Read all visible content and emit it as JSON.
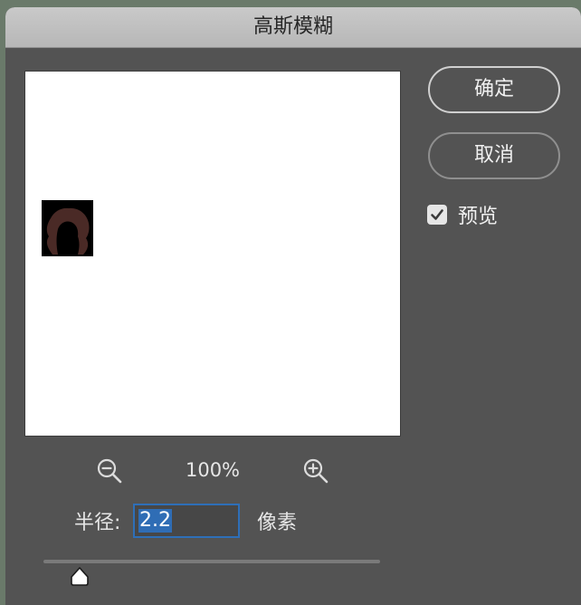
{
  "dialog": {
    "title": "高斯模糊"
  },
  "buttons": {
    "ok_label": "确定",
    "cancel_label": "取消"
  },
  "preview": {
    "label": "预览",
    "checked": true
  },
  "zoom": {
    "level": "100%",
    "zoom_out_icon": "zoom-out-icon",
    "zoom_in_icon": "zoom-in-icon"
  },
  "radius": {
    "label": "半径:",
    "value": "2.2",
    "unit": "像素"
  },
  "colors": {
    "dialog_bg": "#535353",
    "accent": "#2f6db5",
    "preview_bg": "#ffffff"
  }
}
